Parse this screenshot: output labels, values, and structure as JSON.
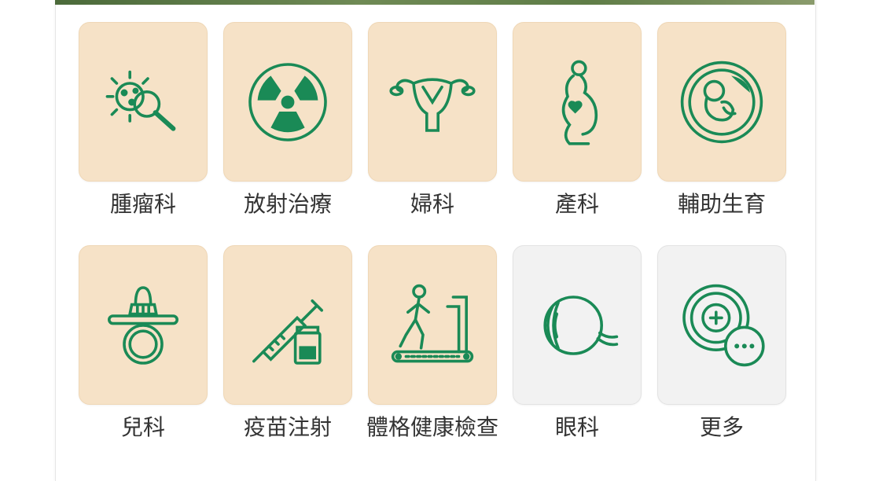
{
  "colors": {
    "tile_bg": "#f6e2c7",
    "tile_bg_inactive": "#f2f2f2",
    "icon_green": "#1a8a56",
    "label_text": "#333333"
  },
  "categories": [
    {
      "label": "腫瘤科",
      "icon": "cancer-cell-magnifier-icon"
    },
    {
      "label": "放射治療",
      "icon": "radiation-icon"
    },
    {
      "label": "婦科",
      "icon": "uterus-icon"
    },
    {
      "label": "產科",
      "icon": "pregnant-woman-icon"
    },
    {
      "label": "輔助生育",
      "icon": "embryo-icon"
    },
    {
      "label": "兒科",
      "icon": "pacifier-icon"
    },
    {
      "label": "疫苗注射",
      "icon": "syringe-vial-icon"
    },
    {
      "label": "體格健康檢查",
      "icon": "treadmill-icon"
    },
    {
      "label": "眼科",
      "icon": "eye-icon"
    },
    {
      "label": "更多",
      "icon": "more-plus-icon"
    }
  ]
}
